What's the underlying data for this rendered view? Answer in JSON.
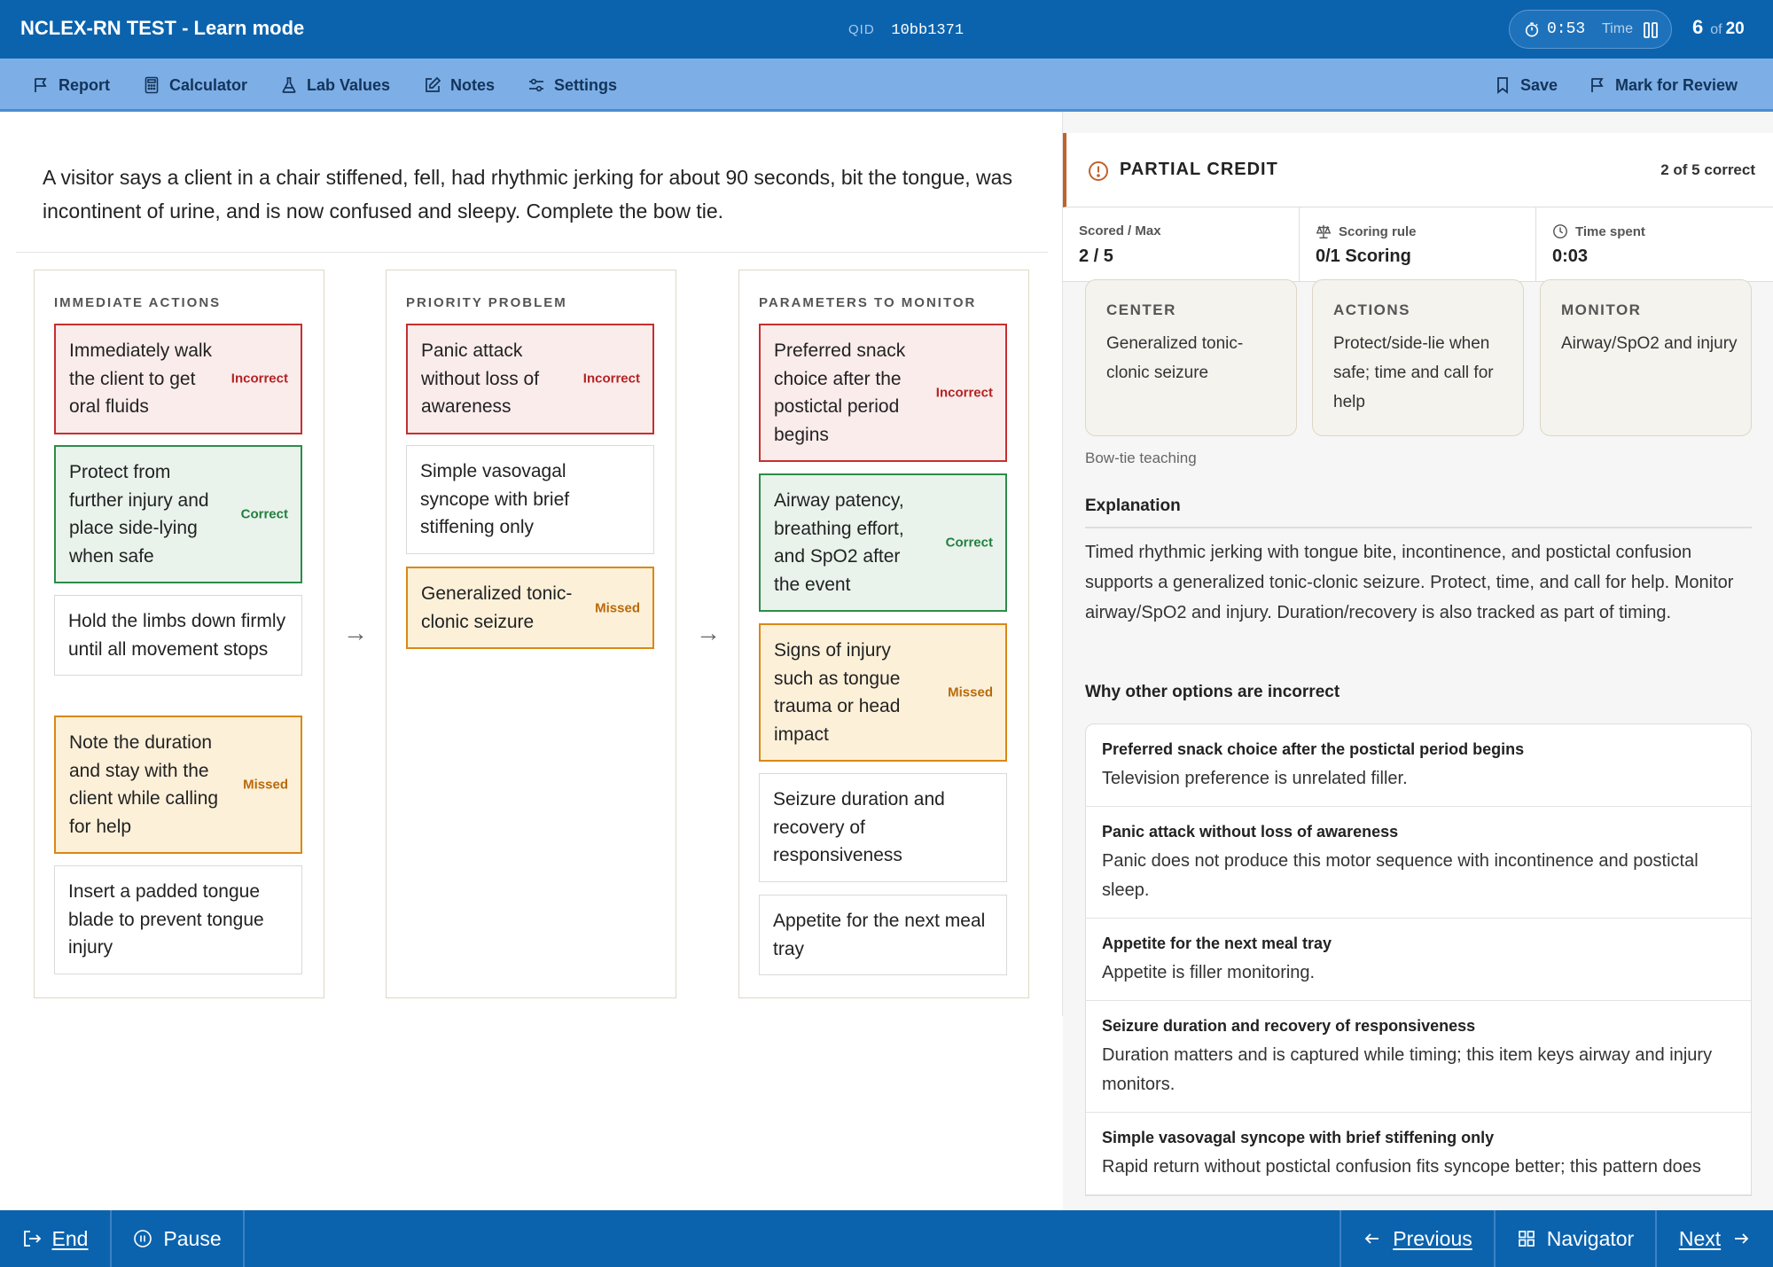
{
  "header": {
    "title": "NCLEX-RN TEST - Learn mode",
    "qid_label": "QID",
    "qid_value": "10bb1371",
    "timer_value": "0:53",
    "timer_label": "Time",
    "question_current": "6",
    "question_of": "of",
    "question_total": "20"
  },
  "toolbar": {
    "report": "Report",
    "calculator": "Calculator",
    "lab_values": "Lab Values",
    "notes": "Notes",
    "settings": "Settings",
    "save": "Save",
    "mark_for_review": "Mark for Review"
  },
  "question": {
    "stem": "A visitor says a client in a chair stiffened, fell, had rhythmic jerking for about 90 seconds, bit the tongue, was incontinent of urine, and is now confused and sleepy. Complete the bow tie."
  },
  "bowtie": {
    "arrow": "→",
    "columns": [
      {
        "heading": "IMMEDIATE ACTIONS",
        "options": [
          {
            "text": "Immediately walk the client to get oral fluids",
            "status": "Incorrect"
          },
          {
            "text": "Protect from further injury and place side-lying when safe",
            "status": "Correct"
          },
          {
            "text": "Hold the limbs down firmly until all movement stops",
            "status": ""
          },
          {
            "text": "Note the duration and stay with the client while calling for help",
            "status": "Missed"
          },
          {
            "text": "Insert a padded tongue blade to prevent tongue injury",
            "status": ""
          }
        ]
      },
      {
        "heading": "PRIORITY PROBLEM",
        "options": [
          {
            "text": "Panic attack without loss of awareness",
            "status": "Incorrect"
          },
          {
            "text": "Simple vasovagal syncope with brief stiffening only",
            "status": ""
          },
          {
            "text": "Generalized tonic-clonic seizure",
            "status": "Missed"
          }
        ]
      },
      {
        "heading": "PARAMETERS TO MONITOR",
        "options": [
          {
            "text": "Preferred snack choice after the postictal period begins",
            "status": "Incorrect"
          },
          {
            "text": "Airway patency, breathing effort, and SpO2 after the event",
            "status": "Correct"
          },
          {
            "text": "Signs of injury such as tongue trauma or head impact",
            "status": "Missed"
          },
          {
            "text": "Seizure duration and recovery of responsiveness",
            "status": ""
          },
          {
            "text": "Appetite for the next meal tray",
            "status": ""
          }
        ]
      }
    ]
  },
  "results": {
    "credit_title": "PARTIAL CREDIT",
    "credit_count": "2 of 5 correct",
    "scored_label": "Scored / Max",
    "scored_value": "2 / 5",
    "rule_label": "Scoring rule",
    "rule_value": "0/1 Scoring",
    "time_label": "Time spent",
    "time_value": "0:03",
    "cards": [
      {
        "title": "CENTER",
        "body": "Generalized tonic-clonic seizure"
      },
      {
        "title": "ACTIONS",
        "body": "Protect/side-lie when safe; time and call for help"
      },
      {
        "title": "MONITOR",
        "body": "Airway/SpO2 and injury"
      }
    ],
    "teaching_note": "Bow-tie teaching",
    "explanation_title": "Explanation",
    "explanation_body": "Timed rhythmic jerking with tongue bite, incontinence, and postictal confusion supports a generalized tonic-clonic seizure. Protect, time, and call for help. Monitor airway/SpO2 and injury. Duration/recovery is also tracked as part of timing.",
    "why_title": "Why other options are incorrect",
    "why_items": [
      {
        "title": "Preferred snack choice after the postictal period begins",
        "body": "Television preference is unrelated filler."
      },
      {
        "title": "Panic attack without loss of awareness",
        "body": "Panic does not produce this motor sequence with incontinence and postictal sleep."
      },
      {
        "title": "Appetite for the next meal tray",
        "body": "Appetite is filler monitoring."
      },
      {
        "title": "Seizure duration and recovery of responsiveness",
        "body": "Duration matters and is captured while timing; this item keys airway and injury monitors."
      },
      {
        "title": "Simple vasovagal syncope with brief stiffening only",
        "body": "Rapid return without postictal confusion fits syncope better; this pattern does"
      }
    ]
  },
  "footer": {
    "end": "End",
    "pause": "Pause",
    "previous": "Previous",
    "navigator": "Navigator",
    "next": "Next"
  },
  "colors": {
    "header_blue": "#0b63ae",
    "toolbar_blue": "#7daee6",
    "incorrect": "#c62f2f",
    "correct": "#2e8b4a",
    "missed": "#d98816",
    "partial_credit_accent": "#c0622c"
  },
  "icons": {
    "report": "flag-icon",
    "calculator": "calculator-icon",
    "lab_values": "flask-icon",
    "notes": "edit-icon",
    "settings": "sliders-icon",
    "save": "bookmark-icon",
    "mark_for_review": "flag-icon",
    "timer": "stopwatch-icon",
    "pause_timer": "pause-icon",
    "partial_credit": "alert-circle-icon",
    "scoring_rule": "scale-icon",
    "time_spent": "clock-icon",
    "end": "exit-icon",
    "pause": "pause-circle-icon",
    "previous": "arrow-left-icon",
    "navigator": "grid-icon",
    "next": "arrow-right-icon"
  }
}
